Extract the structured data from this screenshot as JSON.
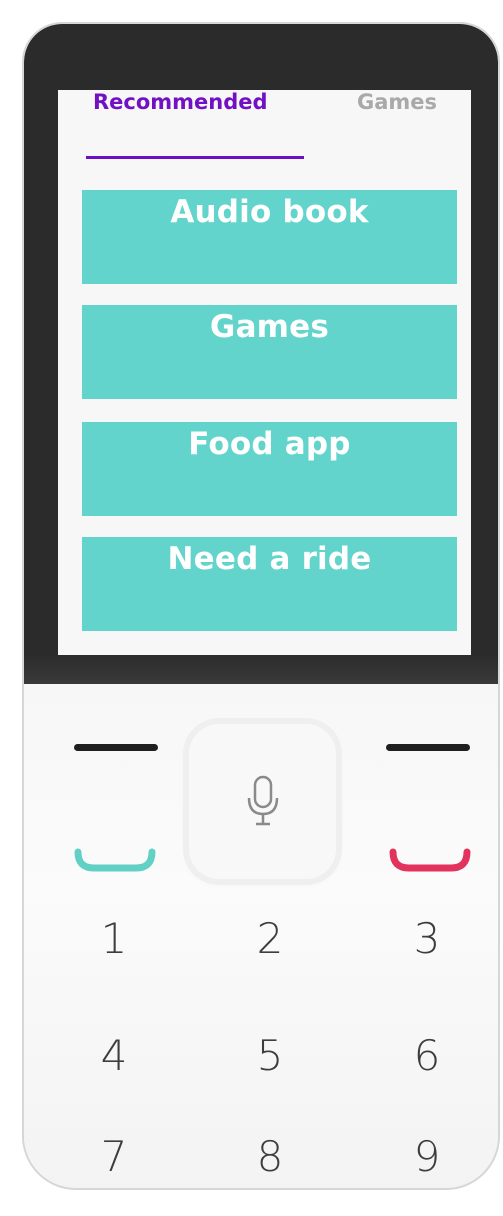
{
  "tabs": [
    {
      "label": "Recommended",
      "active": true
    },
    {
      "label": "Games",
      "active": false
    }
  ],
  "cards": [
    {
      "label": "Audio book"
    },
    {
      "label": "Games"
    },
    {
      "label": "Food app"
    },
    {
      "label": "Need a ride"
    }
  ],
  "keypad": {
    "keys": [
      "1",
      "2",
      "3",
      "4",
      "5",
      "6",
      "7",
      "8",
      "9"
    ]
  },
  "colors": {
    "accent": "#7211c4",
    "card": "#63d4cc",
    "call_green": "#62d0c4",
    "call_red": "#e2325e",
    "inactive_tab": "#a9a9a9"
  },
  "icons": {
    "mic": "microphone-icon",
    "call_accept": "call-accept-icon",
    "call_end": "call-end-icon"
  }
}
